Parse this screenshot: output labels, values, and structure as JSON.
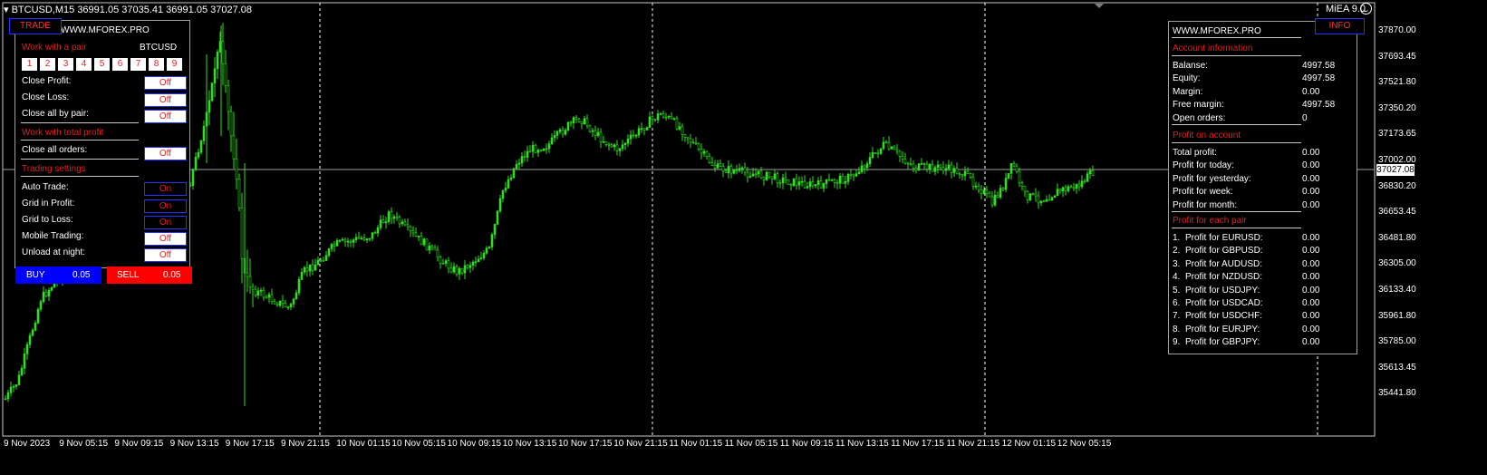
{
  "header": {
    "symbol_line": "▾ BTCUSD,M15  36991.05 37035.41 36991.05 37027.08",
    "ea_label": "MiEA 9.0"
  },
  "trade_panel": {
    "tab": "TRADE",
    "title": "WWW.MFOREX.PRO",
    "section_pair": "Work with a pair",
    "pair": "BTCUSD",
    "pair_numbers": [
      "1",
      "2",
      "3",
      "4",
      "5",
      "6",
      "7",
      "8",
      "9"
    ],
    "rows_pair": [
      {
        "label": "Close Profit:",
        "value": "Off"
      },
      {
        "label": "Close Loss:",
        "value": "Off"
      },
      {
        "label": "Close all by pair:",
        "value": "Off"
      }
    ],
    "section_total": "Work with total profit",
    "rows_total": [
      {
        "label": "Close all orders:",
        "value": "Off"
      }
    ],
    "section_settings": "Trading settings",
    "rows_settings": [
      {
        "label": "Auto Trade:",
        "value": "On"
      },
      {
        "label": "Grid in Profit:",
        "value": "On"
      },
      {
        "label": "Grid to Loss:",
        "value": "On"
      },
      {
        "label": "Mobile Trading:",
        "value": "Off"
      },
      {
        "label": "Unload at night:",
        "value": "Off"
      }
    ],
    "buy": {
      "label": "BUY",
      "lot": "0.05"
    },
    "sell": {
      "label": "SELL",
      "lot": "0.05"
    }
  },
  "info_panel": {
    "tab": "INFO",
    "title": "WWW.MFOREX.PRO",
    "section_account": "Account information",
    "account": [
      {
        "label": "Balanse:",
        "value": "4997.58"
      },
      {
        "label": "Equity:",
        "value": "4997.58"
      },
      {
        "label": "Margin:",
        "value": "0.00"
      },
      {
        "label": "Free margin:",
        "value": "4997.58"
      },
      {
        "label": "Open orders:",
        "value": "0"
      }
    ],
    "section_profit": "Profit on account",
    "profit": [
      {
        "label": "Total profit:",
        "value": "0.00"
      },
      {
        "label": "Profit for today:",
        "value": "0.00"
      },
      {
        "label": "Profit for yesterday:",
        "value": "0.00"
      },
      {
        "label": "Profit for week:",
        "value": "0.00"
      },
      {
        "label": "Profit for month:",
        "value": "0.00"
      }
    ],
    "section_pairs": "Profit for each pair",
    "pairs": [
      {
        "num": "1.",
        "label": "Profit for EURUSD:",
        "value": "0.00"
      },
      {
        "num": "2.",
        "label": "Profit for GBPUSD:",
        "value": "0.00"
      },
      {
        "num": "3.",
        "label": "Profit for AUDUSD:",
        "value": "0.00"
      },
      {
        "num": "4.",
        "label": "Profit for NZDUSD:",
        "value": "0.00"
      },
      {
        "num": "5.",
        "label": "Profit for USDJPY:",
        "value": "0.00"
      },
      {
        "num": "6.",
        "label": "Profit for USDCAD:",
        "value": "0.00"
      },
      {
        "num": "7.",
        "label": "Profit for USDCHF:",
        "value": "0.00"
      },
      {
        "num": "8.",
        "label": "Profit for EURJPY:",
        "value": "0.00"
      },
      {
        "num": "9.",
        "label": "Profit for GBPJPY:",
        "value": "0.00"
      }
    ]
  },
  "price_axis": [
    "37870.00",
    "37693.45",
    "37521.80",
    "37350.20",
    "37173.65",
    "37002.00",
    "36830.20",
    "36653.45",
    "36481.80",
    "36305.00",
    "36133.40",
    "35961.80",
    "35785.00",
    "35613.45",
    "35441.80"
  ],
  "current_price": "37027.08",
  "time_axis": [
    "9 Nov 2023",
    "9 Nov 05:15",
    "9 Nov 09:15",
    "9 Nov 13:15",
    "9 Nov 17:15",
    "9 Nov 21:15",
    "10 Nov 01:15",
    "10 Nov 05:15",
    "10 Nov 09:15",
    "10 Nov 13:15",
    "10 Nov 17:15",
    "10 Nov 21:15",
    "11 Nov 01:15",
    "11 Nov 05:15",
    "11 Nov 09:15",
    "11 Nov 13:15",
    "11 Nov 17:15",
    "11 Nov 21:15",
    "12 Nov 01:15",
    "12 Nov 05:15"
  ],
  "colors": {
    "candle": "#33dd22",
    "panel_accent": "#e02020",
    "tab_border": "#2233ff",
    "buy": "#0000ff",
    "sell": "#ff0000"
  }
}
